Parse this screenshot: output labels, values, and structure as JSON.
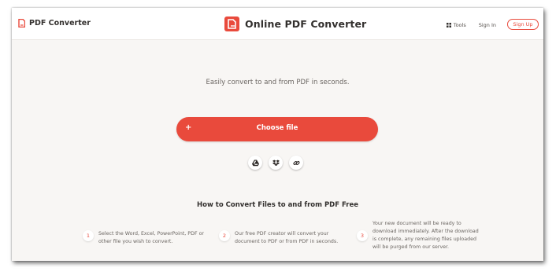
{
  "header": {
    "brand_left": "PDF Converter",
    "brand_center": "Online PDF Converter",
    "nav": {
      "tools_label": "Tools",
      "tools_icon": "grid-icon",
      "signin_label": "Sign In",
      "signup_label": "Sign Up"
    }
  },
  "main": {
    "tagline": "Easily convert to and from PDF in seconds.",
    "choose_button": {
      "plus": "+",
      "label": "Choose file"
    },
    "sources": [
      {
        "icon": "google-drive-icon"
      },
      {
        "icon": "dropbox-icon"
      },
      {
        "icon": "link-icon"
      }
    ],
    "howto": {
      "title": "How to Convert Files to and from PDF Free",
      "steps": [
        {
          "number": "1",
          "lines": [
            "Select the Word, Excel, PowerPoint, PDF or",
            "other file you wish to convert."
          ]
        },
        {
          "number": "2",
          "lines": [
            "Our free PDF creator will convert your",
            "document to PDF or from PDF in seconds."
          ]
        },
        {
          "number": "3",
          "lines": [
            "Your new document will be ready to",
            "download immediately. After the download",
            "is complete, any remaining files uploaded",
            "will be purged from our server."
          ]
        }
      ]
    }
  },
  "colors": {
    "accent": "#e94a3c",
    "background": "#f8f6f4",
    "header_bg": "#ffffff",
    "text_dark": "#33302e",
    "text_muted": "#6b6662"
  }
}
